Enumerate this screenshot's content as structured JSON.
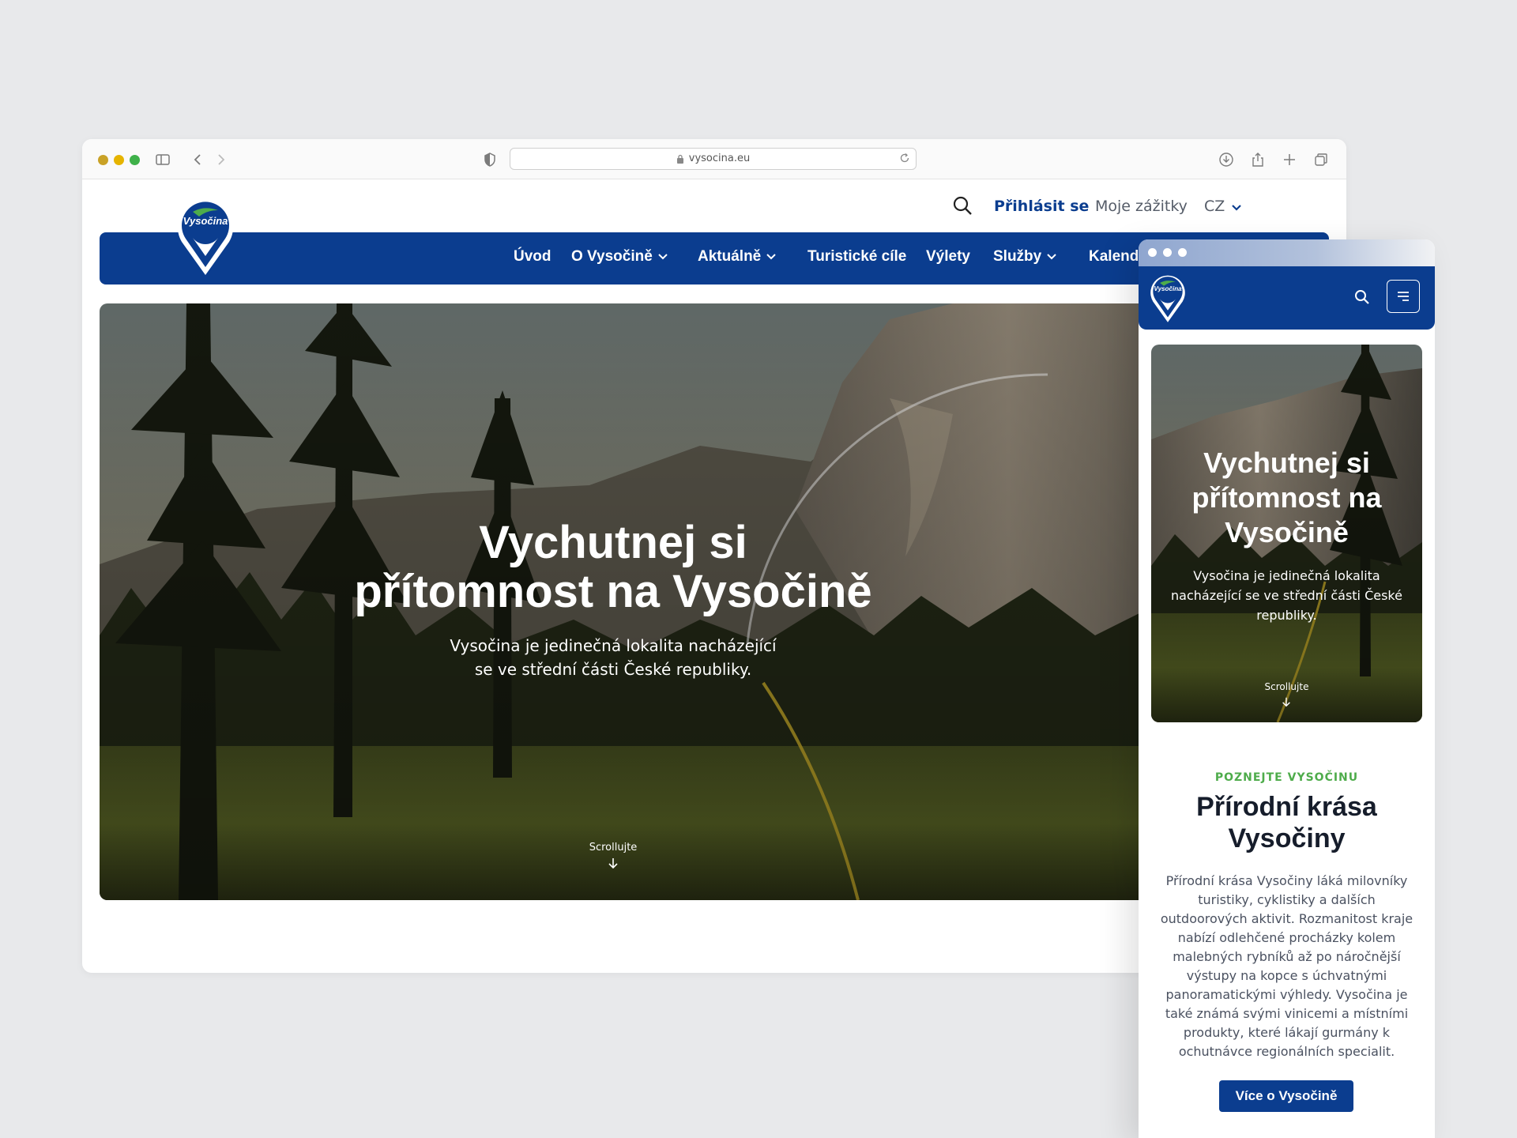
{
  "browser": {
    "url": "vysocina.eu"
  },
  "site": {
    "logo_text": "Vysočina",
    "top_links": {
      "login": "Přihlásit se",
      "experiences": "Moje zážitky",
      "language": "CZ"
    },
    "nav": [
      "Úvod",
      "O Vysočině",
      "Aktuálně",
      "Turistické cíle",
      "Výlety",
      "Služby",
      "Kalendář"
    ]
  },
  "hero": {
    "title_line1": "Vychutnej si",
    "title_line2": "přítomnost na Vysočině",
    "subtitle_line1": "Vysočina je jedinečná lokalita nacházející",
    "subtitle_line2": "se ve střední části České republiky.",
    "scroll_label": "Scrollujte"
  },
  "mobile": {
    "hero": {
      "title_line1": "Vychutnej si",
      "title_line2": "přítomnost na",
      "title_line3": "Vysočině",
      "subtitle": "Vysočina je jedinečná lokalita nacházející se ve střední části České republiky.",
      "scroll_label": "Scrollujte"
    },
    "section": {
      "eyebrow": "POZNEJTE VYSOČINU",
      "title_line1": "Přírodní krása",
      "title_line2": "Vysočiny",
      "body": "Přírodní krása Vysočiny láká milovníky turistiky, cyklistiky a dalších outdoorových aktivit. Rozmanitost kraje nabízí odlehčené procházky kolem malebných rybníků až po náročnější výstupy na kopce s úchvatnými panoramatickými výhledy. Vysočina je také známá svými vinicemi a místními produkty, které lákají gurmány k ochutnávce regionálních specialit.",
      "button": "Více o Vysočině"
    }
  },
  "colors": {
    "brand_blue": "#0b3d8f",
    "accent_green": "#4eac4b",
    "background": "#e8e9eb"
  }
}
